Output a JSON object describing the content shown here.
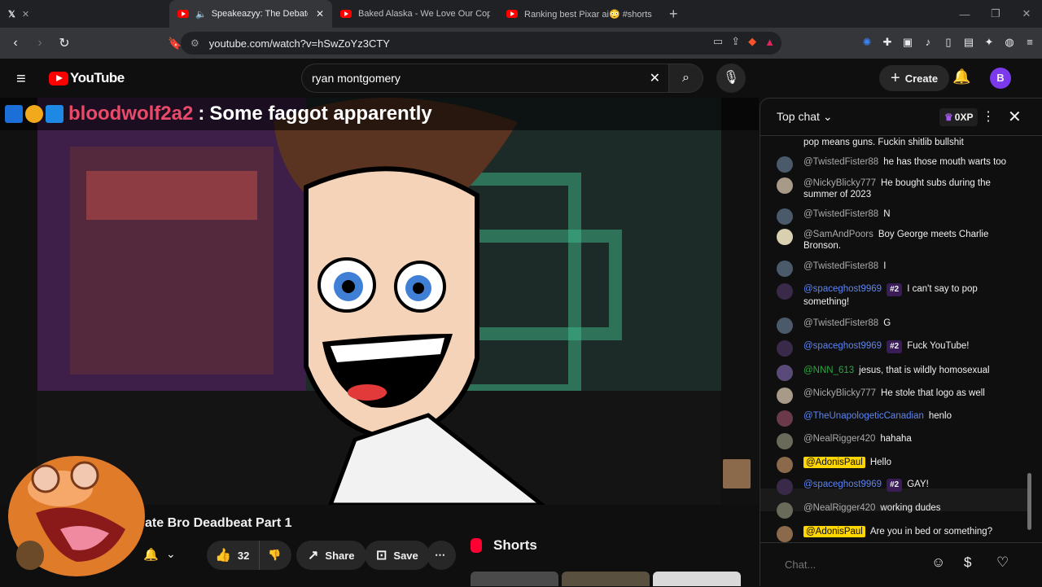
{
  "browser": {
    "tabs": [
      {
        "label": "X",
        "active": false
      },
      {
        "label": "Speakeazyy: The Debate Bro",
        "active": true
      },
      {
        "label": "Baked Alaska - We Love Our Cops [L",
        "active": false
      },
      {
        "label": "Ranking best Pixar ai😳 #shorts #pix",
        "active": false
      }
    ],
    "url": "youtube.com/watch?v=hSwZoYz3CTY"
  },
  "header": {
    "logo_text": "YouTube",
    "search_value": "ryan montgomery",
    "create_label": "Create",
    "avatar_letter": "B"
  },
  "video": {
    "overlay_user": "bloodwolf2a2",
    "overlay_sep": ":",
    "overlay_msg": "Some faggot apparently",
    "title": "ate Bro Deadbeat Part 1"
  },
  "actions": {
    "like_count": "32",
    "share_label": "Share",
    "save_label": "Save"
  },
  "shorts": {
    "label": "Shorts"
  },
  "chat": {
    "header_label": "Top chat",
    "xp_label": "0XP",
    "input_placeholder": "Chat...",
    "messages": [
      {
        "author": "",
        "text": "pop means guns. Fuckin shitlib bullshit",
        "type": "plain",
        "badge": ""
      },
      {
        "author": "@TwistedFister88",
        "text": "he has those mouth warts too",
        "type": "plain",
        "badge": ""
      },
      {
        "author": "@NickyBlicky777",
        "text": "He bought subs during the summer of 2023",
        "type": "plain",
        "badge": ""
      },
      {
        "author": "@TwistedFister88",
        "text": "N",
        "type": "plain",
        "badge": ""
      },
      {
        "author": "@SamAndPoors",
        "text": "Boy George meets Charlie Bronson.",
        "type": "plain",
        "badge": ""
      },
      {
        "author": "@TwistedFister88",
        "text": "I",
        "type": "plain",
        "badge": ""
      },
      {
        "author": "@spaceghost9969",
        "text": "I can't say to pop something!",
        "type": "mod",
        "badge": "#2"
      },
      {
        "author": "@TwistedFister88",
        "text": "G",
        "type": "plain",
        "badge": ""
      },
      {
        "author": "@spaceghost9969",
        "text": "Fuck YouTube!",
        "type": "mod",
        "badge": "#2"
      },
      {
        "author": "@NNN_613",
        "text": "jesus, that is wildly homosexual",
        "type": "mem",
        "badge": ""
      },
      {
        "author": "@NickyBlicky777",
        "text": "He stole that logo as well",
        "type": "plain",
        "badge": ""
      },
      {
        "author": "@TheUnapologeticCanadian",
        "text": "henlo",
        "type": "mod",
        "badge": ""
      },
      {
        "author": "@NealRigger420",
        "text": "hahaha",
        "type": "plain",
        "badge": ""
      },
      {
        "author": "@AdonisPaul",
        "text": "Hello",
        "type": "owner",
        "badge": ""
      },
      {
        "author": "@spaceghost9969",
        "text": "GAY!",
        "type": "mod",
        "badge": "#2"
      },
      {
        "author": "@NealRigger420",
        "text": "working dudes",
        "type": "plain",
        "badge": ""
      },
      {
        "author": "@AdonisPaul",
        "text": "Are you in bed or something?",
        "type": "owner",
        "badge": ""
      }
    ]
  },
  "colors": {
    "accent": "#ff0000",
    "owner": "#ffd600",
    "mod": "#5e84f1",
    "overlay_user": "#e94a6a"
  }
}
